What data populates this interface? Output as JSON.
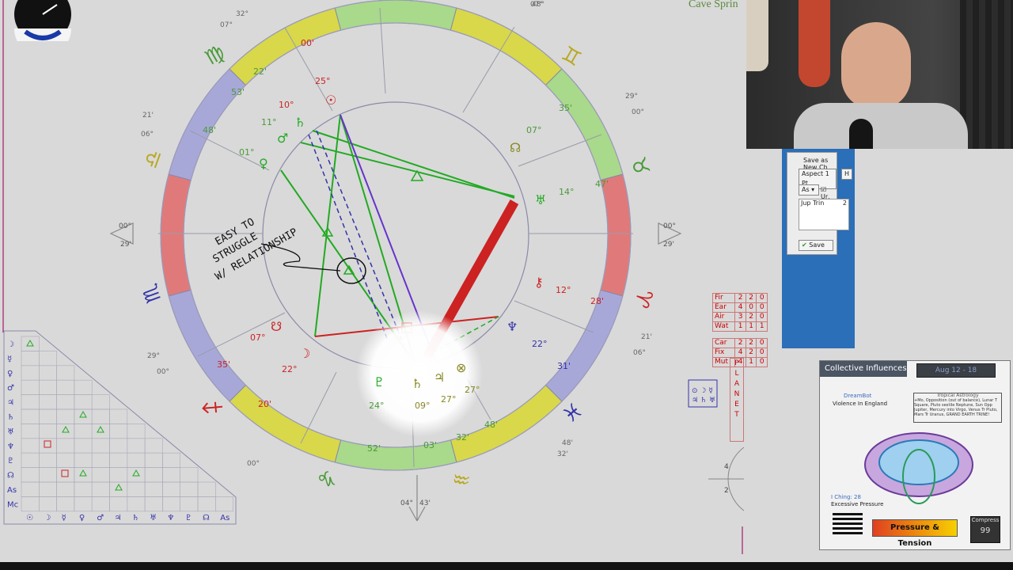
{
  "header": {
    "location_label": "Cave Sprin"
  },
  "chart": {
    "colors": {
      "red": "#cc2222",
      "green": "#22aa22",
      "blue": "#3333aa",
      "purple": "#6633cc",
      "zodiac_yellow": "#d8d84a",
      "zodiac_green": "#a9d98a",
      "zodiac_pink": "#e07a7a",
      "zodiac_lavender": "#a8a8d8"
    },
    "annotation": [
      "EASY TO",
      "STRUGGLE",
      "W/ RELATIONSHIP"
    ],
    "cusps": [
      {
        "deg": "04°",
        "min": "43'"
      },
      {
        "deg": "00°",
        "min": "29'"
      },
      {
        "deg": "00°",
        "min": "29'"
      }
    ],
    "degree_labels": [
      "00'",
      "25°",
      "22'",
      "53'",
      "10°",
      "11°",
      "48'",
      "01°",
      "07°",
      "35'",
      "14°",
      "47'",
      "12°",
      "28'",
      "22°",
      "31'",
      "27°",
      "48'",
      "32'",
      "03'",
      "52'",
      "24°",
      "09°",
      "27°",
      "07°",
      "35'",
      "22°",
      "20'",
      "32°",
      "48°",
      "29°",
      "00°",
      "21'",
      "06°",
      "07°",
      "32'",
      "48'",
      "00°",
      "21'",
      "06°",
      "29°",
      "00°",
      "07°"
    ],
    "aspect_grid_rows": [
      "☽",
      "☿",
      "♀",
      "♂",
      "♃",
      "♄",
      "♅",
      "♆",
      "♇",
      "☊",
      "As",
      "Mc"
    ],
    "aspect_grid_cols": [
      "☉",
      "☽",
      "☿",
      "♀",
      "♂",
      "♃",
      "♄",
      "♅",
      "♆",
      "♇",
      "☊",
      "As"
    ]
  },
  "elements_table": {
    "rows": [
      {
        "label": "Fir",
        "a": "2",
        "b": "2",
        "c": "0"
      },
      {
        "label": "Ear",
        "a": "4",
        "b": "0",
        "c": "0"
      },
      {
        "label": "Air",
        "a": "3",
        "b": "2",
        "c": "0"
      },
      {
        "label": "Wat",
        "a": "1",
        "b": "1",
        "c": "1"
      },
      {
        "label": "Car",
        "a": "2",
        "b": "2",
        "c": "0"
      },
      {
        "label": "Fix",
        "a": "4",
        "b": "2",
        "c": "0"
      },
      {
        "label": "Mut",
        "a": "4",
        "b": "1",
        "c": "0"
      }
    ]
  },
  "aspect_panel": {
    "save_as_new": "Save as New Ch",
    "aspect_label": "Aspect 1 Pt",
    "tab_h": "H",
    "select_value": "As",
    "checkbox_label": "Ur, Ne",
    "text_value": "Jup Trin",
    "text_num": "2",
    "save_label": "Save"
  },
  "info_card": {
    "title": "Collective Influences",
    "date": "Aug 12 - 18",
    "dream_label": "DreamBot",
    "dream_text": "Violence In England",
    "tropical_title": "Tropical Astrology",
    "tropical_text": "+Mo, Opposition (out of balance), Lunar T Square, Pluto sextile Neptune, Sun Opp Jupiter, Mercury into Virgo, Venus Tr Pluto, Mars Tr Uranus, GRAND EARTH TRINE!",
    "iching_label": "I Ching: 28",
    "iching_text": "Excessive Pressure",
    "pressure_label": "Pressure & Tension",
    "compress_label": "Compress",
    "compress_value": "99"
  }
}
